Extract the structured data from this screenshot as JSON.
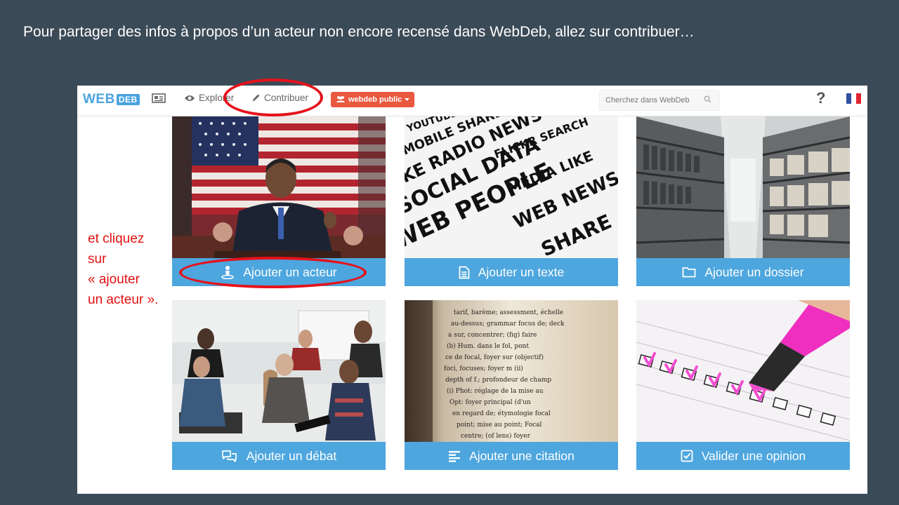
{
  "slide": {
    "title": "Pour partager des infos à propos d’un acteur non encore recensé dans WebDeb, allez sur contribuer…",
    "annotation_lines": [
      "et cliquez",
      "sur",
      "« ajouter",
      "un acteur »."
    ]
  },
  "navbar": {
    "logo_web": "WEB",
    "logo_deb": "DEB",
    "explore_label": "Explorer",
    "contribute_label": "Contribuer",
    "group_button_label": "webdeb public",
    "search_placeholder": "Cherchez dans WebDeb",
    "help_label": "?",
    "language": "French"
  },
  "cards": [
    {
      "label": "Ajouter un acteur",
      "icon": "person-icon"
    },
    {
      "label": "Ajouter un texte",
      "icon": "file-text-icon"
    },
    {
      "label": "Ajouter un dossier",
      "icon": "folder-icon"
    },
    {
      "label": "Ajouter un débat",
      "icon": "comments-icon"
    },
    {
      "label": "Ajouter une citation",
      "icon": "align-left-icon"
    },
    {
      "label": "Valider une opinion",
      "icon": "check-square-icon"
    }
  ],
  "colors": {
    "slide_bg": "#3b4a57",
    "card_bar": "#4da6de",
    "highlight_ring": "#e5121b",
    "group_button": "#e9583f"
  }
}
